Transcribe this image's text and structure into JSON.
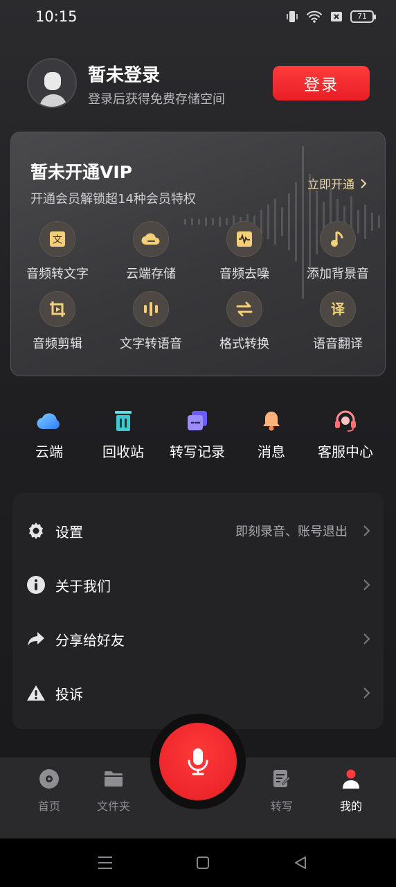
{
  "status_bar": {
    "time": "10:15",
    "battery": "71"
  },
  "profile": {
    "title": "暂未登录",
    "subtitle": "登录后获得免费存储空间",
    "login_label": "登录"
  },
  "vip": {
    "title": "暂未开通VIP",
    "subtitle": "开通会员解锁超14种会员特权",
    "open_label": "立即开通",
    "features": [
      {
        "label": "音频转文字",
        "icon": "text-icon"
      },
      {
        "label": "云端存储",
        "icon": "cloud-icon"
      },
      {
        "label": "音频去噪",
        "icon": "denoise-icon"
      },
      {
        "label": "添加背景音",
        "icon": "music-note-icon"
      },
      {
        "label": "音频剪辑",
        "icon": "crop-icon"
      },
      {
        "label": "文字转语音",
        "icon": "voice-bars-icon"
      },
      {
        "label": "格式转换",
        "icon": "swap-icon"
      },
      {
        "label": "语音翻译",
        "icon": "translate-icon"
      }
    ]
  },
  "quick_actions": [
    {
      "label": "云端",
      "icon": "cloud-icon"
    },
    {
      "label": "回收站",
      "icon": "trash-icon"
    },
    {
      "label": "转写记录",
      "icon": "transcript-icon"
    },
    {
      "label": "消息",
      "icon": "bell-icon"
    },
    {
      "label": "客服中心",
      "icon": "headset-icon"
    }
  ],
  "menu": [
    {
      "label": "设置",
      "value": "即刻录音、账号退出",
      "icon": "gear-icon"
    },
    {
      "label": "关于我们",
      "value": "",
      "icon": "info-icon"
    },
    {
      "label": "分享给好友",
      "value": "",
      "icon": "share-icon"
    },
    {
      "label": "投诉",
      "value": "",
      "icon": "warning-icon"
    }
  ],
  "bottom_nav": [
    {
      "label": "首页",
      "icon": "home-disc-icon",
      "active": false
    },
    {
      "label": "文件夹",
      "icon": "folder-icon",
      "active": false
    },
    {
      "label": "转写",
      "icon": "edit-note-icon",
      "active": false
    },
    {
      "label": "我的",
      "icon": "person-icon",
      "active": true
    }
  ],
  "colors": {
    "accent_red": "#e81f25",
    "vip_gold": "#f3d9a6",
    "background": "#1f1f22"
  }
}
